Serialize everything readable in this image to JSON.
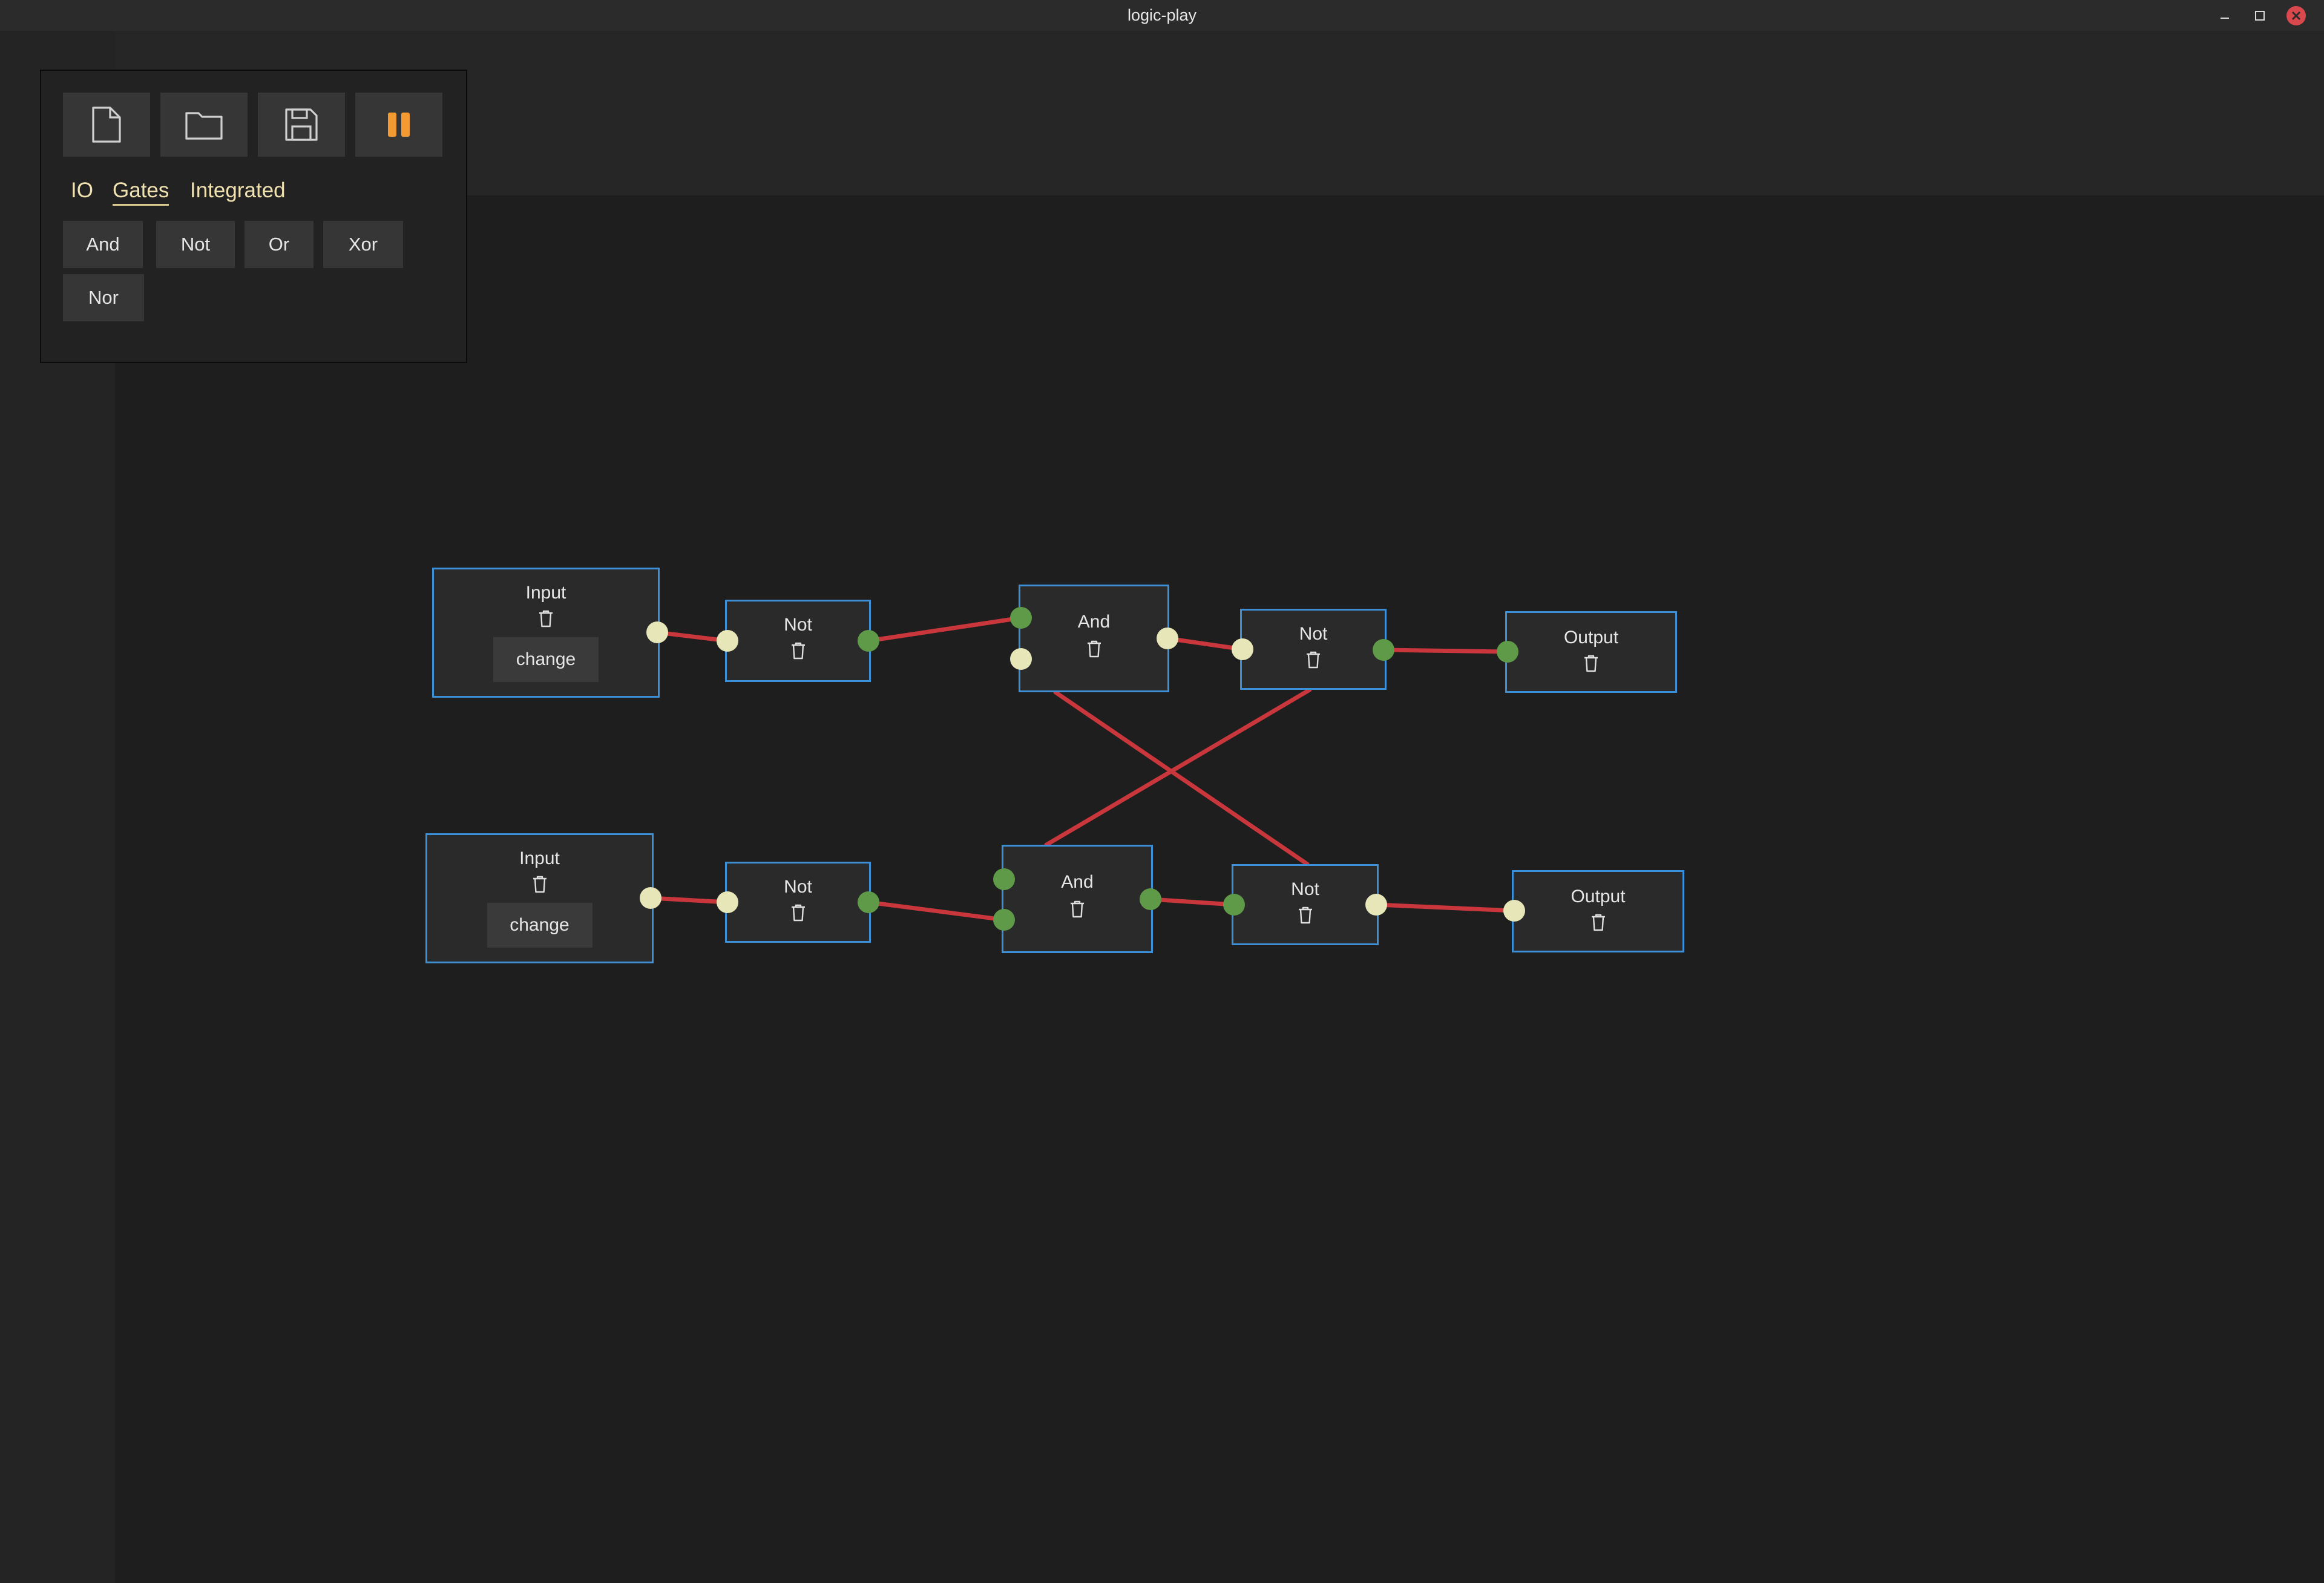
{
  "window": {
    "title": "logic-play"
  },
  "toolbar": {
    "icons": [
      "new-file-icon",
      "open-folder-icon",
      "save-icon",
      "pause-icon"
    ],
    "accent_color": "#f39a33"
  },
  "tabs": [
    "IO",
    "Gates",
    "Integrated"
  ],
  "active_tab": "Gates",
  "gate_buttons": [
    "And",
    "Not",
    "Or",
    "Xor",
    "Nor"
  ],
  "colors": {
    "node_border": "#3d8fd8",
    "wire": "#c9373c",
    "pin_on": "#e6e6b8",
    "pin_off": "#5e9a48"
  },
  "nodes": [
    {
      "id": "in1",
      "label": "Input",
      "button": "change"
    },
    {
      "id": "not1",
      "label": "Not"
    },
    {
      "id": "and1",
      "label": "And"
    },
    {
      "id": "not2",
      "label": "Not"
    },
    {
      "id": "out1",
      "label": "Output"
    },
    {
      "id": "in2",
      "label": "Input",
      "button": "change"
    },
    {
      "id": "not3",
      "label": "Not"
    },
    {
      "id": "and2",
      "label": "And"
    },
    {
      "id": "not4",
      "label": "Not"
    },
    {
      "id": "out2",
      "label": "Output"
    }
  ]
}
